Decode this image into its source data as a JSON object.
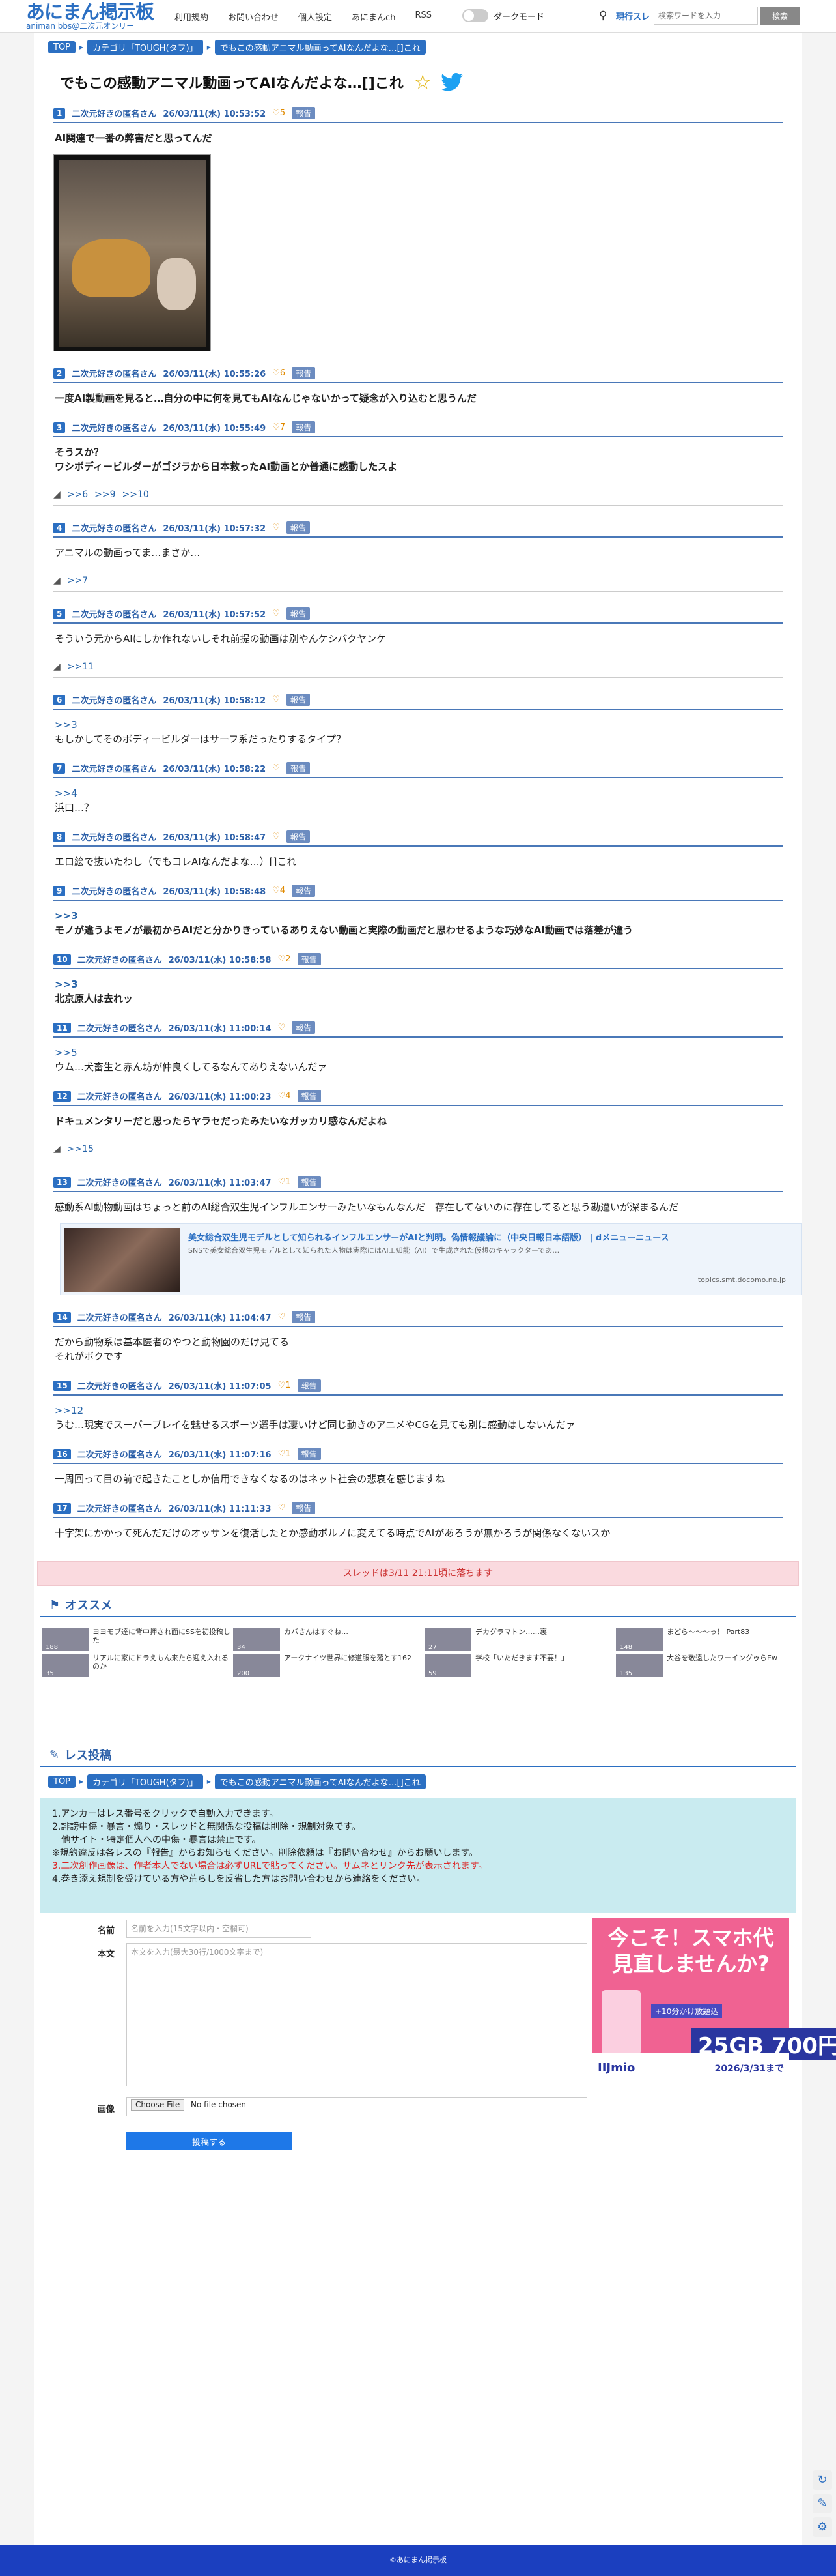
{
  "header": {
    "logo": "あにまん掲示板",
    "logo_sub": "animan bbs@二次元オンリー",
    "nav": [
      "利用規約",
      "お問い合わせ",
      "個人設定",
      "あにまんch",
      "RSS"
    ],
    "dark_mode": "ダークモード",
    "search_label": "現行スレ",
    "search_placeholder": "検索ワードを入力",
    "search_button": "検索"
  },
  "breadcrumb": [
    "TOP",
    "カテゴリ「TOUGH(タフ)」",
    "でもこの感動アニマル動画ってAIなんだよな…[]これ"
  ],
  "thread_title": "でもこの感動アニマル動画ってAIなんだよな…[]これ",
  "posts": [
    {
      "no": "1",
      "name": "二次元好きの匿名さん",
      "date": "26/03/11(水) 10:53:52",
      "likes": "5",
      "report": "報告",
      "body": "AI関連で一番の弊害だと思ってんだ",
      "bold": true,
      "has_image": true,
      "replies": []
    },
    {
      "no": "2",
      "name": "二次元好きの匿名さん",
      "date": "26/03/11(水) 10:55:26",
      "likes": "6",
      "report": "報告",
      "body": "一度AI製動画を見ると…自分の中に何を見てもAIなんじゃないかって疑念が入り込むと思うんだ",
      "bold": true,
      "replies": []
    },
    {
      "no": "3",
      "name": "二次元好きの匿名さん",
      "date": "26/03/11(水) 10:55:49",
      "likes": "7",
      "report": "報告",
      "body": "そうスか？\nワシボディービルダーがゴジラから日本救ったAI動画とか普通に感動したスよ",
      "bold": true,
      "replies": [
        ">>6",
        ">>9",
        ">>10"
      ]
    },
    {
      "no": "4",
      "name": "二次元好きの匿名さん",
      "date": "26/03/11(水) 10:57:32",
      "likes": "",
      "report": "報告",
      "body": "アニマルの動画ってま…まさか…",
      "bold": false,
      "replies": [
        ">>7"
      ]
    },
    {
      "no": "5",
      "name": "二次元好きの匿名さん",
      "date": "26/03/11(水) 10:57:52",
      "likes": "",
      "report": "報告",
      "body": "そういう元からAIにしか作れないしそれ前提の動画は別やんケシバクヤンケ",
      "bold": false,
      "replies": [
        ">>11"
      ]
    },
    {
      "no": "6",
      "name": "二次元好きの匿名さん",
      "date": "26/03/11(水) 10:58:12",
      "likes": "",
      "report": "報告",
      "anchor": ">>3",
      "body": "もしかしてそのボディービルダーはサーフ系だったりするタイプ？",
      "bold": false,
      "replies": []
    },
    {
      "no": "7",
      "name": "二次元好きの匿名さん",
      "date": "26/03/11(水) 10:58:22",
      "likes": "",
      "report": "報告",
      "anchor": ">>4",
      "body": "浜口…？",
      "bold": false,
      "replies": []
    },
    {
      "no": "8",
      "name": "二次元好きの匿名さん",
      "date": "26/03/11(水) 10:58:47",
      "likes": "",
      "report": "報告",
      "body": "エロ絵で抜いたわし（でもコレAIなんだよな…）[]これ",
      "bold": false,
      "replies": []
    },
    {
      "no": "9",
      "name": "二次元好きの匿名さん",
      "date": "26/03/11(水) 10:58:48",
      "likes": "4",
      "report": "報告",
      "anchor": ">>3",
      "body": "モノが違うよモノが最初からAIだと分かりきっているありえない動画と実際の動画だと思わせるような巧妙なAI動画では落差が違う",
      "bold": true,
      "replies": []
    },
    {
      "no": "10",
      "name": "二次元好きの匿名さん",
      "date": "26/03/11(水) 10:58:58",
      "likes": "2",
      "report": "報告",
      "anchor": ">>3",
      "body": "北京原人は去れッ",
      "bold": true,
      "replies": []
    },
    {
      "no": "11",
      "name": "二次元好きの匿名さん",
      "date": "26/03/11(水) 11:00:14",
      "likes": "",
      "report": "報告",
      "anchor": ">>5",
      "body": "ウム…犬畜生と赤ん坊が仲良くしてるなんてありえないんだァ",
      "bold": false,
      "replies": []
    },
    {
      "no": "12",
      "name": "二次元好きの匿名さん",
      "date": "26/03/11(水) 11:00:23",
      "likes": "4",
      "report": "報告",
      "body": "ドキュメンタリーだと思ったらヤラセだったみたいなガッカリ感なんだよね",
      "bold": true,
      "replies": [
        ">>15"
      ]
    },
    {
      "no": "13",
      "name": "二次元好きの匿名さん",
      "date": "26/03/11(水) 11:03:47",
      "likes": "1",
      "report": "報告",
      "body": "感動系AI動物動画はちょっと前のAI総合双生児インフルエンサーみたいなもんなんだ　存在してないのに存在してると思う勘違いが深まるんだ",
      "bold": false,
      "has_link": true,
      "replies": []
    },
    {
      "no": "14",
      "name": "二次元好きの匿名さん",
      "date": "26/03/11(水) 11:04:47",
      "likes": "",
      "report": "報告",
      "body": "だから動物系は基本医者のやつと動物園のだけ見てる\nそれがボクです",
      "bold": false,
      "replies": []
    },
    {
      "no": "15",
      "name": "二次元好きの匿名さん",
      "date": "26/03/11(水) 11:07:05",
      "likes": "1",
      "report": "報告",
      "anchor": ">>12",
      "body": "うむ…現実でスーパープレイを魅せるスポーツ選手は凄いけど同じ動きのアニメやCGを見ても別に感動はしないんだァ",
      "bold": false,
      "replies": []
    },
    {
      "no": "16",
      "name": "二次元好きの匿名さん",
      "date": "26/03/11(水) 11:07:16",
      "likes": "1",
      "report": "報告",
      "body": "一周回って目の前で起きたことしか信用できなくなるのはネット社会の悲哀を感じますね",
      "bold": false,
      "replies": []
    },
    {
      "no": "17",
      "name": "二次元好きの匿名さん",
      "date": "26/03/11(水) 11:11:33",
      "likes": "",
      "report": "報告",
      "body": "十字架にかかって死んだだけのオッサンを復活したとか感動ポルノに変えてる時点でAIがあろうが無かろうが関係なくないスか",
      "bold": false,
      "replies": []
    }
  ],
  "link_card": {
    "title": "美女総合双生児モデルとして知られるインフルエンサーがAIと判明。偽情報議論に（中央日報日本語版） | dメニューニュース",
    "desc": "SNSで美女総合双生児モデルとして知られた人物は実際にはAI工知能（AI）で生成された仮想のキャラクターであ…",
    "source": "topics.smt.docomo.ne.jp"
  },
  "deadline": "スレッドは3/11 21:11頃に落ちます",
  "recommend_title": "オススメ",
  "recommend": [
    {
      "text": "ヨヨモブ達に背中押され面にSSを初投稿した",
      "count": "188"
    },
    {
      "text": "カバさんはすぐね…",
      "count": "34"
    },
    {
      "text": "デカグラマトン……裏",
      "count": "27"
    },
    {
      "text": "まどら〜〜〜っ！ Part83",
      "count": "148"
    },
    {
      "text": "リアルに家にドラえもん来たら迎え入れるのか",
      "count": "35"
    },
    {
      "text": "アークナイツ世界に修道服を落とす162",
      "count": "200"
    },
    {
      "text": "学校「いただきます不要！」",
      "count": "59"
    },
    {
      "text": "大谷を敬遠したワーイングゥらEw",
      "count": "135"
    }
  ],
  "form": {
    "title": "レス投稿",
    "rules": [
      "1.アンカーはレス番号をクリックで自動入力できます。",
      "2.誹謗中傷・暴言・煽り・スレッドと無関係な投稿は削除・規制対象です。",
      "　他サイト・特定個人への中傷・暴言は禁止です。",
      "※規約違反は各レスの『報告』からお知らせください。削除依頼は『お問い合わせ』からお願いします。",
      "3.二次創作画像は、作者本人でない場合は必ずURLで貼ってください。サムネとリンク先が表示されます。",
      "4.巻き添え規制を受けている方や荒らしを反省した方はお問い合わせから連絡をください。"
    ],
    "name_label": "名前",
    "name_placeholder": "名前を入力(15文字以内・空欄可)",
    "body_label": "本文",
    "body_placeholder": "本文を入力(最大30行/1000文字まで)",
    "image_label": "画像",
    "file_button": "Choose File",
    "file_status": "No file chosen",
    "submit": "投稿する"
  },
  "ad": {
    "line1": "今こそ！スマホ代",
    "line2": "見直しませんか?",
    "tag": "+10分かけ放題込",
    "price": "25GB 700円",
    "brand": "IIJmio",
    "until": "2026/3/31まで"
  },
  "footer": "©あにまん掲示板"
}
